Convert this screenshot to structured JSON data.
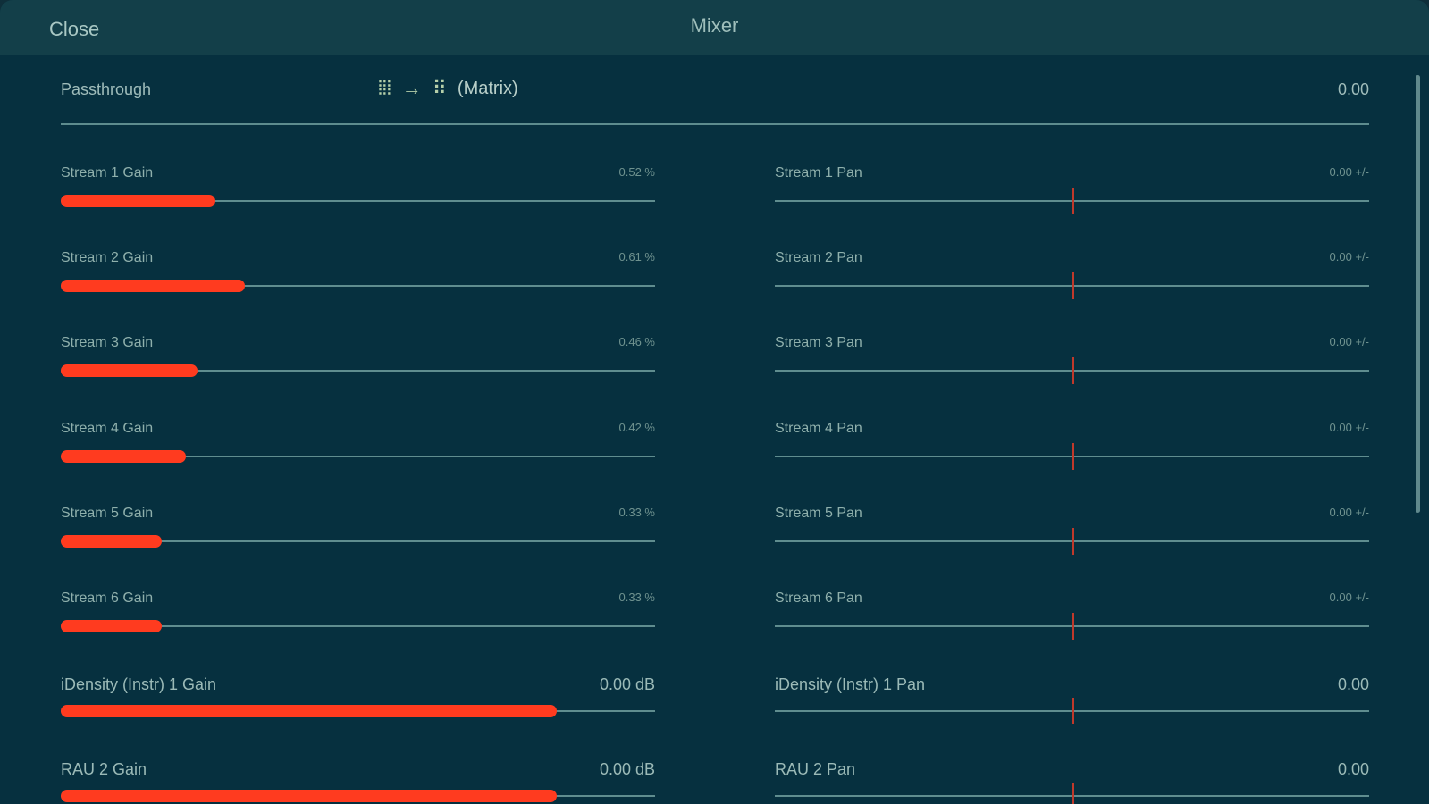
{
  "titlebar": {
    "close_label": "Close",
    "title": "Mixer"
  },
  "passthrough": {
    "label": "Passthrough",
    "glyph_left": "⦙⦙⦙",
    "arrow": "→",
    "glyph_right": "⠿",
    "matrix_label": "(Matrix)",
    "value": "0.00"
  },
  "colors": {
    "accent": "#ff3b1f",
    "background": "#06303f",
    "titlebar": "#133f49",
    "track": "#5f8d8f"
  },
  "gains": [
    {
      "label": "Stream 1 Gain",
      "value": "0.52 %",
      "level": 0.26,
      "big": false
    },
    {
      "label": "Stream 2 Gain",
      "value": "0.61 %",
      "level": 0.31,
      "big": false
    },
    {
      "label": "Stream 3 Gain",
      "value": "0.46 %",
      "level": 0.23,
      "big": false
    },
    {
      "label": "Stream 4 Gain",
      "value": "0.42 %",
      "level": 0.21,
      "big": false
    },
    {
      "label": "Stream 5 Gain",
      "value": "0.33 %",
      "level": 0.17,
      "big": false
    },
    {
      "label": "Stream 6 Gain",
      "value": "0.33 %",
      "level": 0.17,
      "big": false
    },
    {
      "label": "iDensity (Instr) 1 Gain",
      "value": "0.00 dB",
      "level": 0.835,
      "big": true
    },
    {
      "label": "RAU 2 Gain",
      "value": "0.00 dB",
      "level": 0.835,
      "big": true
    }
  ],
  "pans": [
    {
      "label": "Stream 1 Pan",
      "value": "0.00 +/-",
      "position": 0.5,
      "big": false
    },
    {
      "label": "Stream 2 Pan",
      "value": "0.00 +/-",
      "position": 0.5,
      "big": false
    },
    {
      "label": "Stream 3 Pan",
      "value": "0.00 +/-",
      "position": 0.5,
      "big": false
    },
    {
      "label": "Stream 4 Pan",
      "value": "0.00 +/-",
      "position": 0.5,
      "big": false
    },
    {
      "label": "Stream 5 Pan",
      "value": "0.00 +/-",
      "position": 0.5,
      "big": false
    },
    {
      "label": "Stream 6 Pan",
      "value": "0.00 +/-",
      "position": 0.5,
      "big": false
    },
    {
      "label": "iDensity (Instr) 1 Pan",
      "value": "0.00",
      "position": 0.5,
      "big": true
    },
    {
      "label": "RAU 2 Pan",
      "value": "0.00",
      "position": 0.5,
      "big": true
    }
  ]
}
